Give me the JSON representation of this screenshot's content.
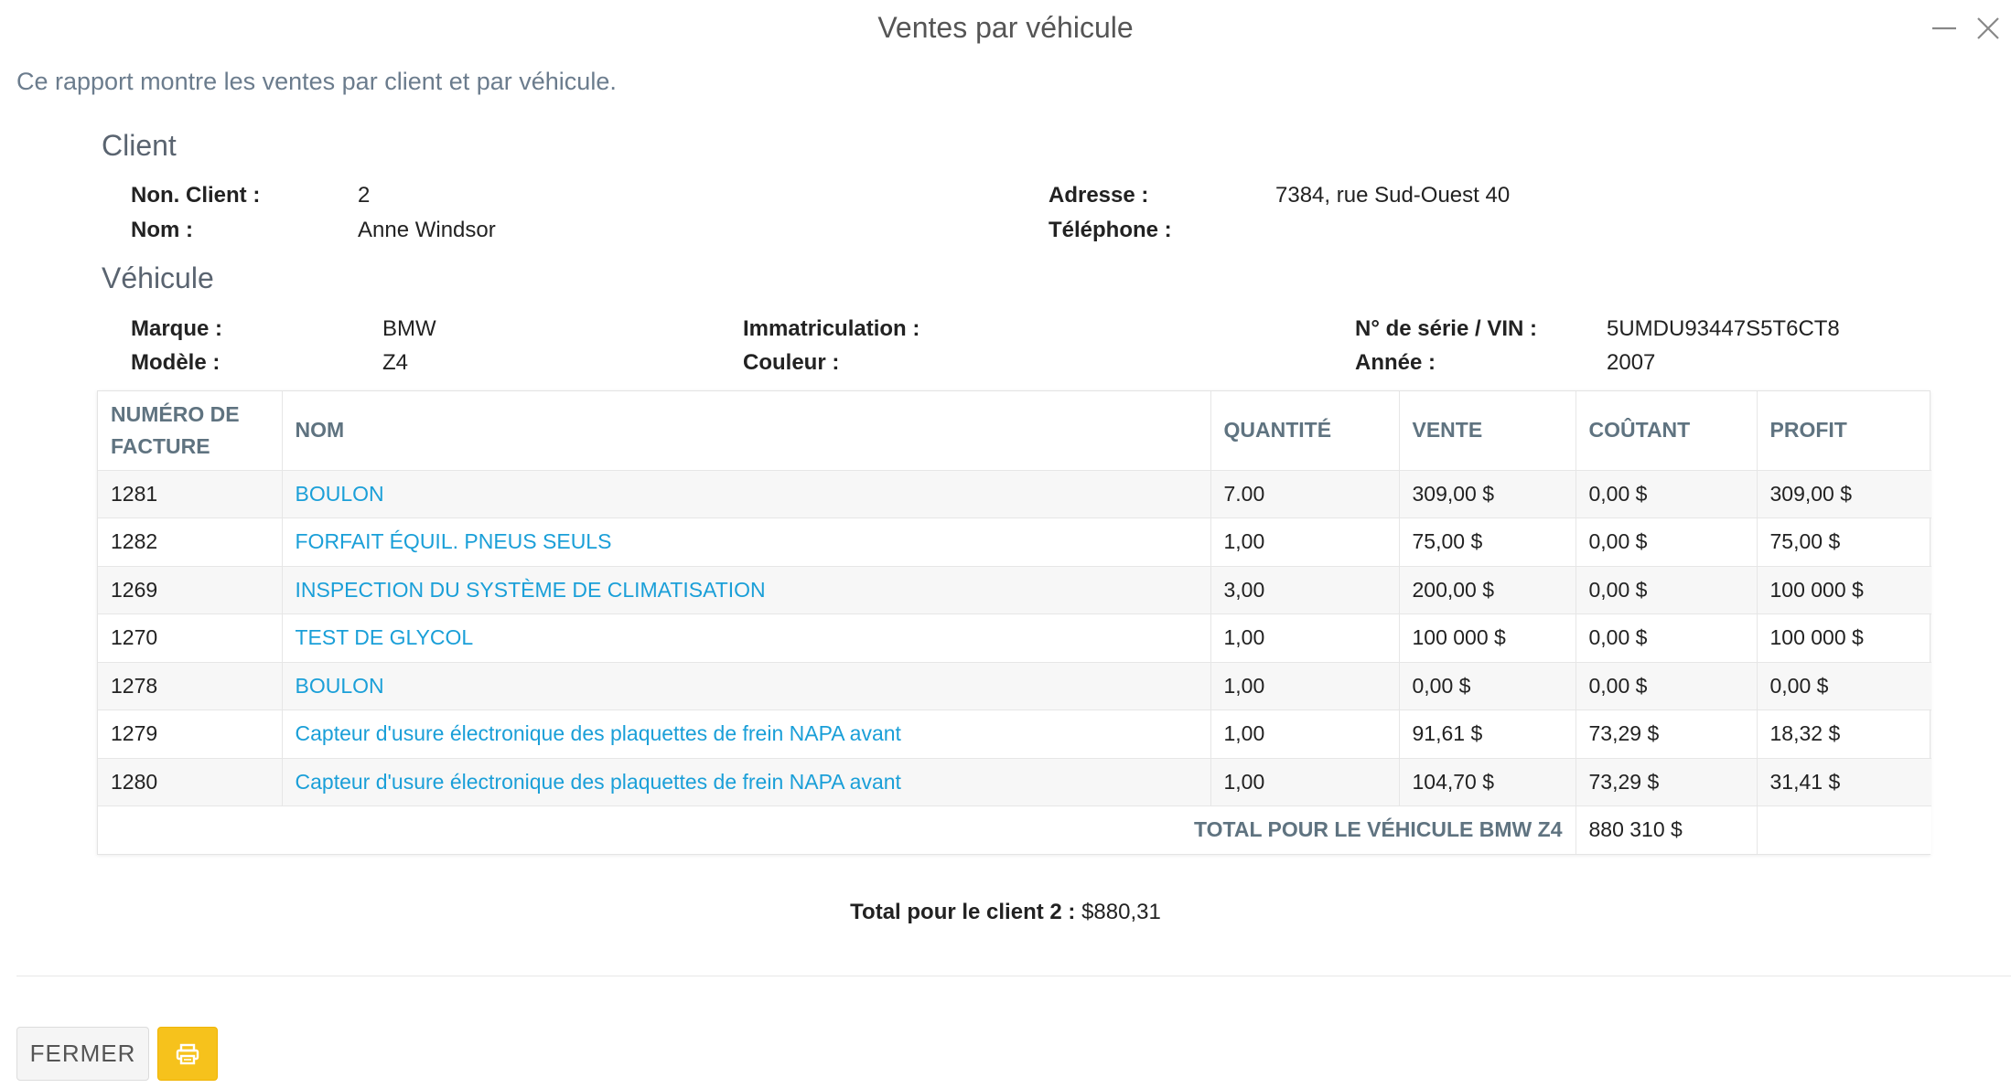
{
  "modal": {
    "title": "Ventes par véhicule",
    "description": "Ce rapport montre les ventes par client et par véhicule."
  },
  "client": {
    "section_title": "Client",
    "number_label": "Non. Client :",
    "number_value": "2",
    "name_label": "Nom :",
    "name_value": "Anne Windsor",
    "address_label": "Adresse :",
    "address_value": "7384, rue Sud-Ouest 40",
    "phone_label": "Téléphone :",
    "phone_value": ""
  },
  "vehicle": {
    "section_title": "Véhicule",
    "make_label": "Marque :",
    "make_value": "BMW",
    "model_label": "Modèle :",
    "model_value": "Z4",
    "plate_label": "Immatriculation :",
    "plate_value": "",
    "color_label": "Couleur :",
    "color_value": "",
    "vin_label": "N° de série / VIN :",
    "vin_value": "5UMDU93447S5T6CT8",
    "year_label": "Année :",
    "year_value": "2007"
  },
  "table": {
    "headers": {
      "invoice": "Numéro de facture",
      "name": "Nom",
      "quantity": "Quantité",
      "sale": "Vente",
      "cost": "Coûtant",
      "profit": "Profit"
    },
    "rows": [
      {
        "invoice": "1281",
        "name": "BOULON",
        "quantity": "7.00",
        "sale": "309,00 $",
        "cost": "0,00 $",
        "profit": "309,00 $"
      },
      {
        "invoice": "1282",
        "name": "FORFAIT ÉQUIL. PNEUS SEULS",
        "quantity": "1,00",
        "sale": "75,00 $",
        "cost": "0,00 $",
        "profit": "75,00 $"
      },
      {
        "invoice": "1269",
        "name": "INSPECTION DU SYSTÈME DE CLIMATISATION",
        "quantity": "3,00",
        "sale": "200,00 $",
        "cost": "0,00 $",
        "profit": "100 000 $"
      },
      {
        "invoice": "1270",
        "name": "TEST DE GLYCOL",
        "quantity": "1,00",
        "sale": "100 000 $",
        "cost": "0,00 $",
        "profit": "100 000 $"
      },
      {
        "invoice": "1278",
        "name": "BOULON",
        "quantity": "1,00",
        "sale": "0,00 $",
        "cost": "0,00 $",
        "profit": "0,00 $"
      },
      {
        "invoice": "1279",
        "name": "Capteur d'usure électronique des plaquettes de frein NAPA avant",
        "quantity": "1,00",
        "sale": "91,61 $",
        "cost": "73,29 $",
        "profit": "18,32 $"
      },
      {
        "invoice": "1280",
        "name": "Capteur d'usure électronique des plaquettes de frein NAPA avant",
        "quantity": "1,00",
        "sale": "104,70 $",
        "cost": "73,29 $",
        "profit": "31,41 $"
      }
    ],
    "total_label": "TOTAL POUR LE VÉHICULE BMW Z4",
    "total_value": "880 310 $"
  },
  "client_total": {
    "label": "Total pour le client 2 :",
    "value": "$880,31"
  },
  "footer": {
    "close_label": "FERMER"
  },
  "icons": {
    "print": "print-icon",
    "minimize": "minimize-icon",
    "close": "close-icon"
  },
  "colors": {
    "link": "#1a9fd8",
    "print_button": "#f6c21c",
    "header_text": "#5f7380"
  }
}
